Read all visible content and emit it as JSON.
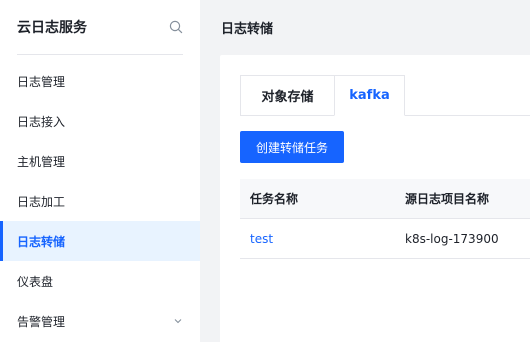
{
  "sidebar": {
    "title": "云日志服务",
    "items": [
      {
        "label": "日志管理"
      },
      {
        "label": "日志接入"
      },
      {
        "label": "主机管理"
      },
      {
        "label": "日志加工"
      },
      {
        "label": "日志转储",
        "active": true
      },
      {
        "label": "仪表盘"
      },
      {
        "label": "告警管理",
        "has_submenu": true
      }
    ]
  },
  "main": {
    "title": "日志转储",
    "tabs": [
      {
        "label": "对象存储"
      },
      {
        "label": "kafka",
        "active": true
      }
    ],
    "create_button": "创建转储任务",
    "table": {
      "columns": [
        "任务名称",
        "源日志项目名称"
      ],
      "rows": [
        [
          "test",
          "k8s-log-173900"
        ]
      ]
    }
  },
  "colors": {
    "accent": "#1664ff",
    "active_bg": "#e8f3ff",
    "page_bg": "#f2f3f5"
  },
  "icons": [
    "search-icon",
    "chevron-down-icon"
  ]
}
